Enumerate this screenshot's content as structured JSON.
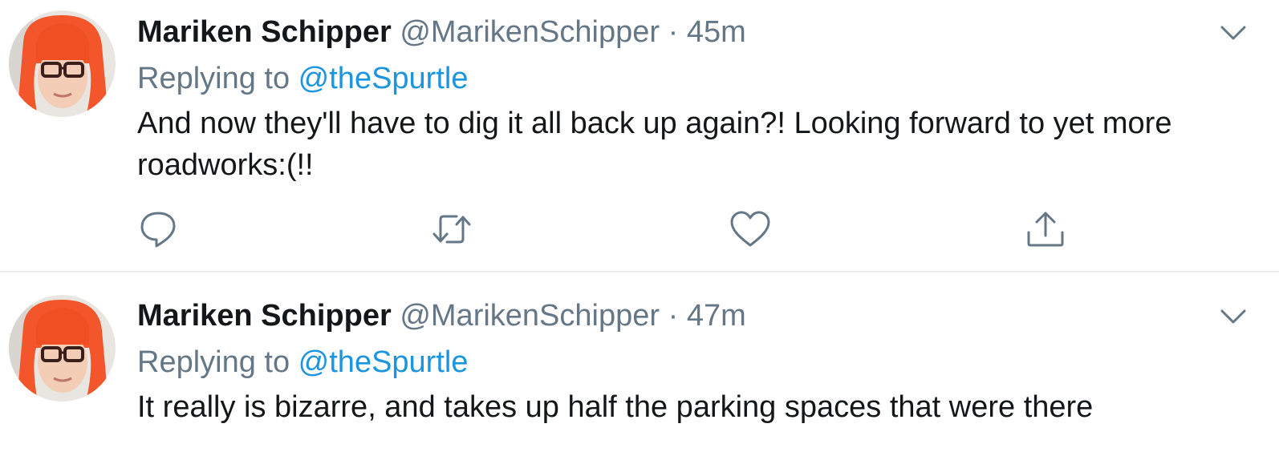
{
  "tweets": [
    {
      "author_name": "Mariken Schipper",
      "handle": "@MarikenSchipper",
      "separator": "·",
      "time": "45m",
      "replying_prefix": "Replying to ",
      "replying_to": "@theSpurtle",
      "text": "And now they'll have to dig it all back up again?! Looking forward to yet more roadworks:(!!",
      "avatar_icon": "avatar-photo",
      "menu_icon": "chevron-down-icon",
      "actions": [
        "reply-icon",
        "retweet-icon",
        "like-icon",
        "share-icon"
      ]
    },
    {
      "author_name": "Mariken Schipper",
      "handle": "@MarikenSchipper",
      "separator": "·",
      "time": "47m",
      "replying_prefix": "Replying to ",
      "replying_to": "@theSpurtle",
      "text": "It really is bizarre, and takes up half the parking spaces that were there",
      "avatar_icon": "avatar-photo",
      "menu_icon": "chevron-down-icon"
    }
  ],
  "colors": {
    "primary_text": "#14171a",
    "secondary_text": "#657786",
    "link": "#1b95e0",
    "divider": "#e6ecf0",
    "icon": "#657786"
  }
}
